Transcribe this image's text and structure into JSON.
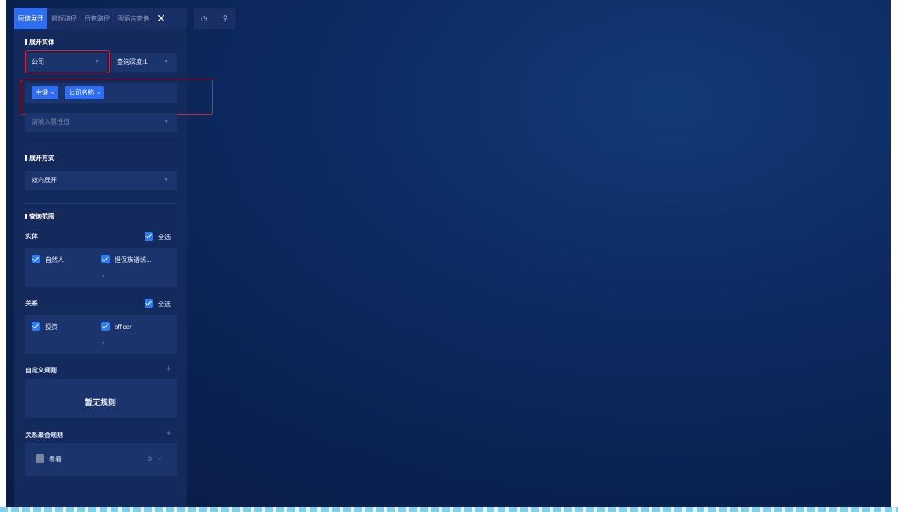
{
  "tabs": [
    {
      "label": "图谱展开",
      "active": true
    },
    {
      "label": "最短路径",
      "active": false
    },
    {
      "label": "所有路径",
      "active": false
    },
    {
      "label": "图语言查询",
      "active": false
    }
  ],
  "tab_close": "✕",
  "toolbox": {
    "clock_icon": "◷",
    "pin_icon": "⚲"
  },
  "expand_entity": {
    "title": "展开实体",
    "entity_select": "公司",
    "depth_select": "查询深度:1",
    "tags": [
      "主键",
      "公司名称"
    ],
    "tag_remove": "×",
    "attr_placeholder": "请输入属性值"
  },
  "expand_mode": {
    "title": "展开方式",
    "value": "双向展开"
  },
  "query_scope": {
    "title": "查询范围",
    "entity_label": "实体",
    "entity_select_all": "全选",
    "entities": [
      "自然人",
      "担保族谱统..."
    ],
    "relation_label": "关系",
    "relation_select_all": "全选",
    "relations": [
      "投资",
      "officer"
    ]
  },
  "custom_rules": {
    "title": "自定义规则",
    "add": "+",
    "empty": "暂无规则"
  },
  "aggregate_rules": {
    "title": "关系聚合规则",
    "add": "+",
    "items": [
      {
        "name": "看看",
        "checked": false
      }
    ]
  },
  "colors": {
    "accent": "#2d6ef5",
    "highlight": "#e41e2b",
    "panel": "#152a5c",
    "canvas": "#0a2150"
  }
}
